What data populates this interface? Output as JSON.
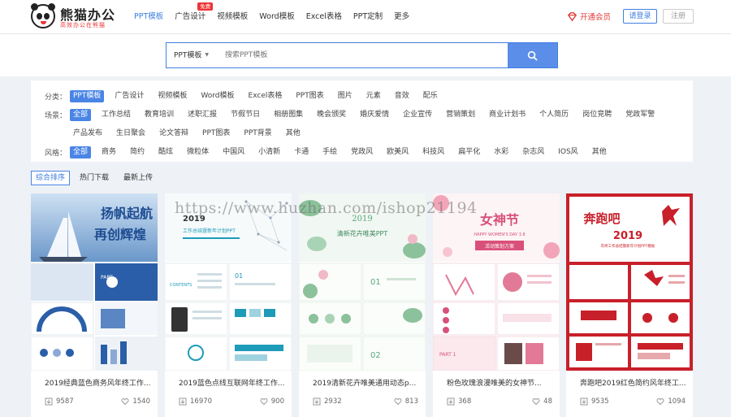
{
  "header": {
    "logo_name": "熊猫办公",
    "logo_slogan": "高效办公在熊猫",
    "nav": [
      {
        "label": "PPT模板"
      },
      {
        "label": "广告设计",
        "badge": "免费"
      },
      {
        "label": "视频模板"
      },
      {
        "label": "Word模板"
      },
      {
        "label": "Excel表格"
      },
      {
        "label": "PPT定制"
      },
      {
        "label": "更多"
      }
    ],
    "vip_label": "开通会员",
    "login_label": "请登录",
    "register_label": "注册"
  },
  "search": {
    "type_label": "PPT模板",
    "placeholder": "搜索PPT模板"
  },
  "filters": {
    "category": {
      "label": "分类：",
      "tags": [
        "PPT模板",
        "广告设计",
        "视频模板",
        "Word模板",
        "Excel表格",
        "PPT图表",
        "图片",
        "元素",
        "音效",
        "配乐"
      ]
    },
    "scene": {
      "label": "场景：",
      "tags_row1": [
        "全部",
        "工作总结",
        "教育培训",
        "述职汇报",
        "节假节日",
        "相册图集",
        "晚会颁奖",
        "婚庆爱情",
        "企业宣传",
        "营销策划",
        "商业计划书",
        "个人简历",
        "岗位竞聘",
        "党政军警"
      ],
      "tags_row2": [
        "产品发布",
        "生日聚会",
        "论文答辩",
        "PPT图表",
        "PPT背景",
        "其他"
      ]
    },
    "style": {
      "label": "风格：",
      "tags": [
        "全部",
        "商务",
        "简约",
        "酷炫",
        "微粒体",
        "中国风",
        "小清新",
        "卡通",
        "手绘",
        "党政风",
        "欧美风",
        "科技风",
        "扁平化",
        "水彩",
        "杂志风",
        "IOS风",
        "其他"
      ]
    }
  },
  "sort": [
    "综合排序",
    "热门下载",
    "最新上传"
  ],
  "cards": [
    {
      "title": "2019经典蓝色商务风年终工作...",
      "downloads": "9587",
      "likes": "1540",
      "thumb_text": [
        "扬帆起航",
        "再创辉煌",
        "PART"
      ],
      "accent": "#2a5ea8"
    },
    {
      "title": "2019蓝色点线互联网年终工作...",
      "downloads": "16970",
      "likes": "900",
      "thumb_text": [
        "2019",
        "工作总结暨新年计划PPT",
        "CONTENTS",
        "01"
      ],
      "accent": "#1e9bb8"
    },
    {
      "title": "2019清新花卉唯美通用动态p...",
      "downloads": "2932",
      "likes": "813",
      "thumb_text": [
        "2019",
        "清新花卉唯美PPT",
        "01",
        "02"
      ],
      "accent": "#57a87a"
    },
    {
      "title": "粉色玫瑰浪漫唯美的女神节...",
      "downloads": "368",
      "likes": "48",
      "thumb_text": [
        "女神节",
        "HAPPY WOMEN'S DAY 3.8",
        "活动策划方案",
        "PART 1"
      ],
      "accent": "#d9507a"
    },
    {
      "title": "奔跑吧2019红色简约风年终工...",
      "downloads": "9535",
      "likes": "1094",
      "thumb_text": [
        "奔跑吧",
        "2019",
        "年终工作总结暨新年计划PPT模板"
      ],
      "accent": "#c8202a"
    }
  ],
  "watermark": "https://www.huzhan.com/ishop21194",
  "colors": {
    "primary": "#3f7fe0",
    "search_button": "#5a8ee8",
    "vip": "#e23b3b",
    "page_bg": "#eef1f5"
  }
}
